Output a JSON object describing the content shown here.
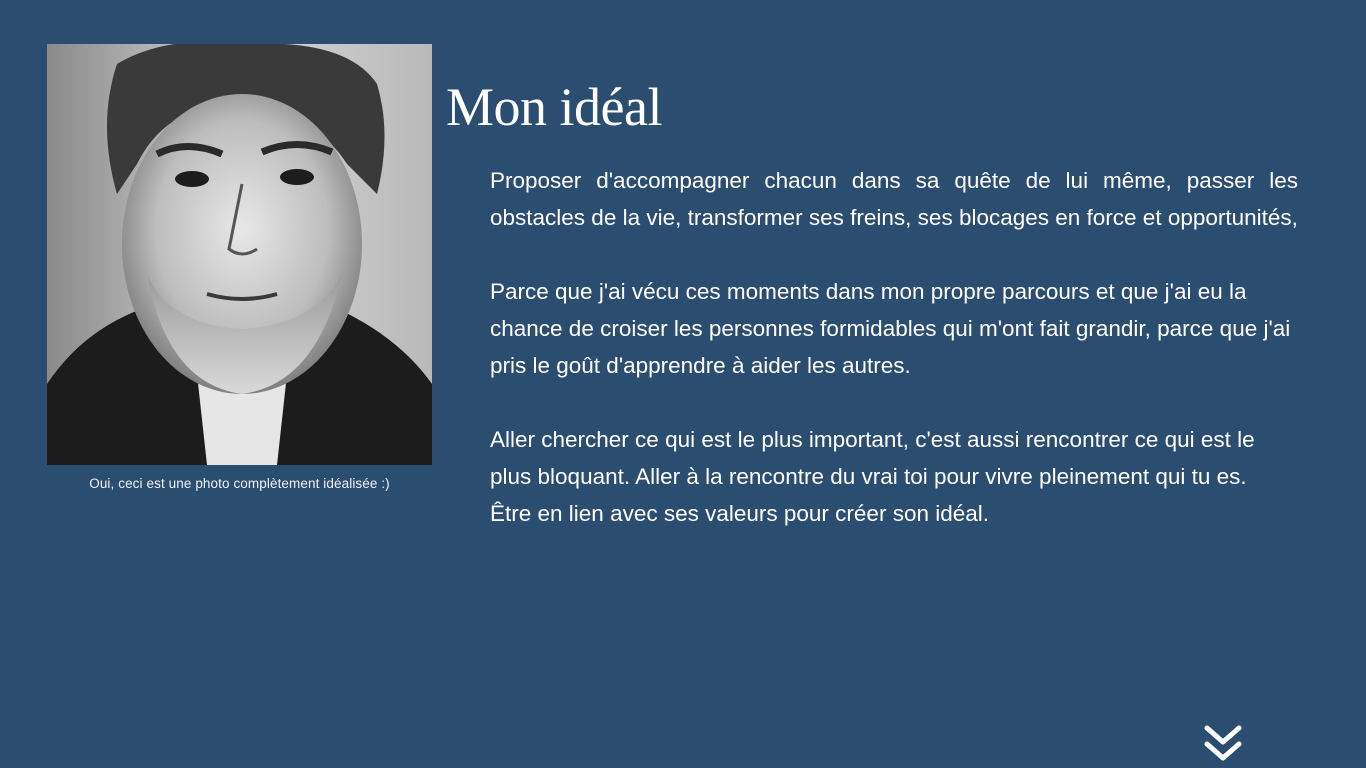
{
  "section": {
    "title": "Mon idéal"
  },
  "photo": {
    "caption": "Oui, ceci est une photo complètement idéalisée :)"
  },
  "content": {
    "paragraph_1": "Proposer d'accompagner chacun dans sa quête de lui même, passer les obstacles de la vie, transformer ses freins, ses blocages en force et opportunités,",
    "paragraph_2": "Parce que j'ai vécu ces moments dans mon propre parcours et que j'ai eu la chance de croiser les personnes formidables qui m'ont fait grandir, parce que j'ai pris le goût d'apprendre à aider les autres.",
    "paragraph_3": "Aller chercher ce qui est le plus important, c'est aussi rencontrer ce qui est le plus bloquant. Aller à la rencontre du vrai toi pour vivre pleinement qui tu es.",
    "paragraph_4": "Être en lien avec ses valeurs pour créer son idéal."
  },
  "navigation": {
    "scroll_icon": "double-chevron-down-icon"
  },
  "colors": {
    "background": "#2b4d70",
    "text": "#ffffff"
  }
}
